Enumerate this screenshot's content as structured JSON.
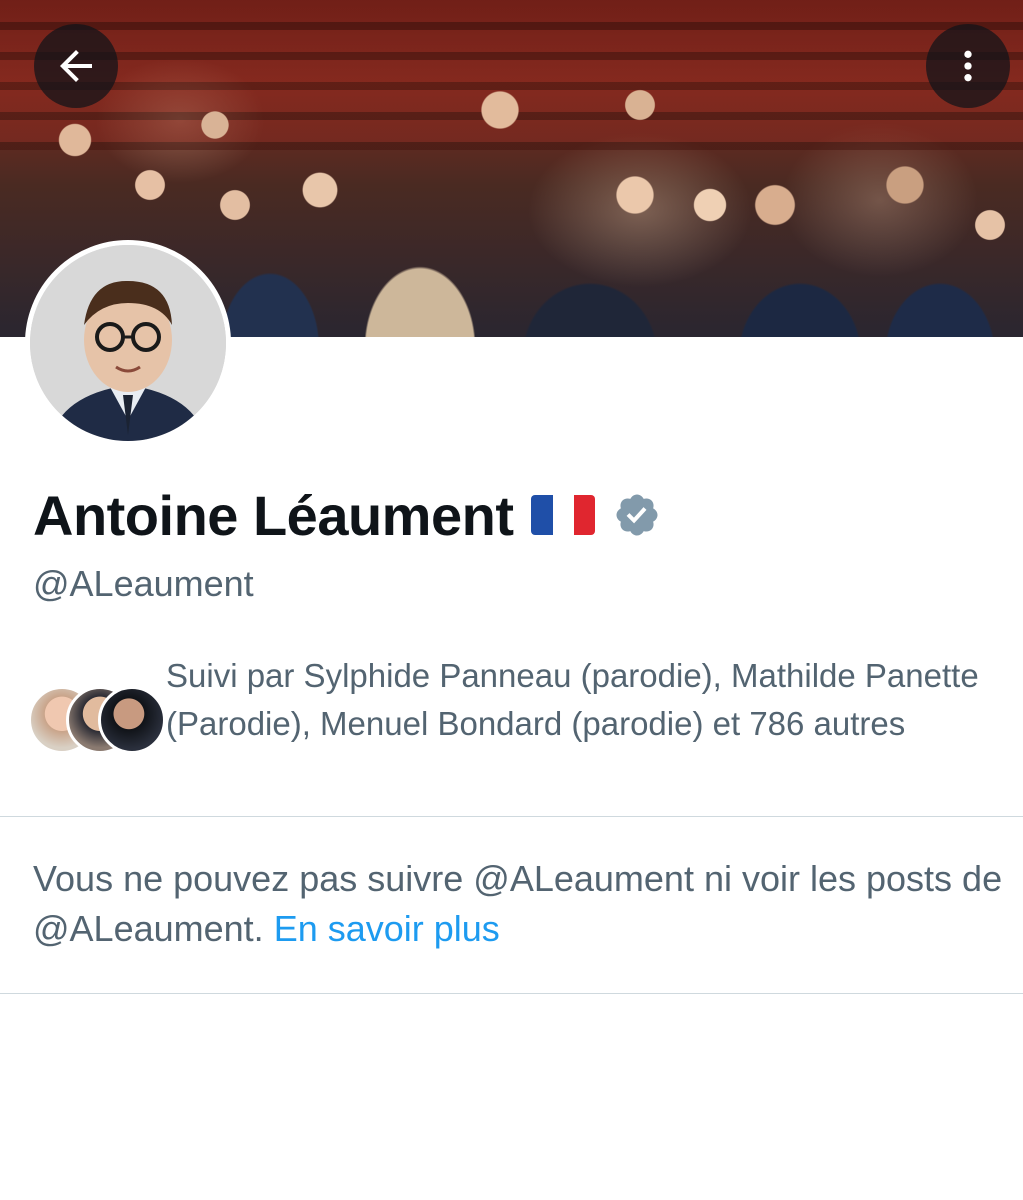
{
  "header": {
    "back_icon": "arrow-left-icon",
    "more_icon": "more-vertical-icon"
  },
  "profile": {
    "name": "Antoine Léaument",
    "flag": "🇫🇷",
    "verified_icon": "verified-badge-icon",
    "verified_color": "#829aab",
    "handle": "@ALeaument"
  },
  "followed_by": {
    "text": "Suivi par Sylphide Panneau (parodie), Mathilde Panette (Parodie), Menuel Bondard (parodie) et 786 autres"
  },
  "notice": {
    "text": "Vous ne pouvez pas suivre @ALeaument ni voir les posts de @ALeaument.",
    "link_label": "En savoir plus",
    "link_color": "#1d9bf0"
  }
}
